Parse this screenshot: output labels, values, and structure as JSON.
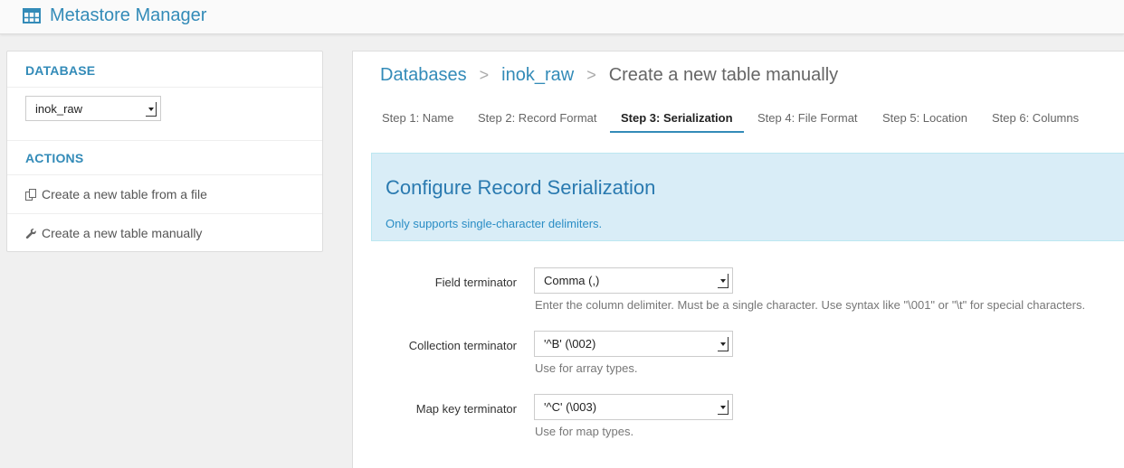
{
  "app": {
    "title": "Metastore Manager",
    "icon": "table-icon"
  },
  "sidebar": {
    "database_header": "DATABASE",
    "database_select": {
      "value": "inok_raw"
    },
    "actions_header": "ACTIONS",
    "actions": [
      {
        "label": "Create a new table from a file",
        "icon": "copy-icon"
      },
      {
        "label": "Create a new table manually",
        "icon": "wrench-icon"
      }
    ]
  },
  "breadcrumb": {
    "items": [
      "Databases",
      "inok_raw"
    ],
    "separator": ">",
    "current": "Create a new table manually"
  },
  "tabs": [
    {
      "label": "Step 1: Name",
      "active": false
    },
    {
      "label": "Step 2: Record Format",
      "active": false
    },
    {
      "label": "Step 3: Serialization",
      "active": true
    },
    {
      "label": "Step 4: File Format",
      "active": false
    },
    {
      "label": "Step 5: Location",
      "active": false
    },
    {
      "label": "Step 6: Columns",
      "active": false
    }
  ],
  "info": {
    "title": "Configure Record Serialization",
    "subtitle": "Only supports single-character delimiters."
  },
  "form": {
    "fields": [
      {
        "label": "Field terminator",
        "value": "Comma (,)",
        "help": "Enter the column delimiter. Must be a single character. Use syntax like \"\\001\" or \"\\t\" for special characters."
      },
      {
        "label": "Collection terminator",
        "value": "'^B' (\\002)",
        "help": "Use for array types."
      },
      {
        "label": "Map key terminator",
        "value": "'^C' (\\003)",
        "help": "Use for map types."
      }
    ]
  },
  "colors": {
    "accent": "#338bb8",
    "info_bg": "#d9edf7",
    "page_bg": "#f0f0f0"
  }
}
